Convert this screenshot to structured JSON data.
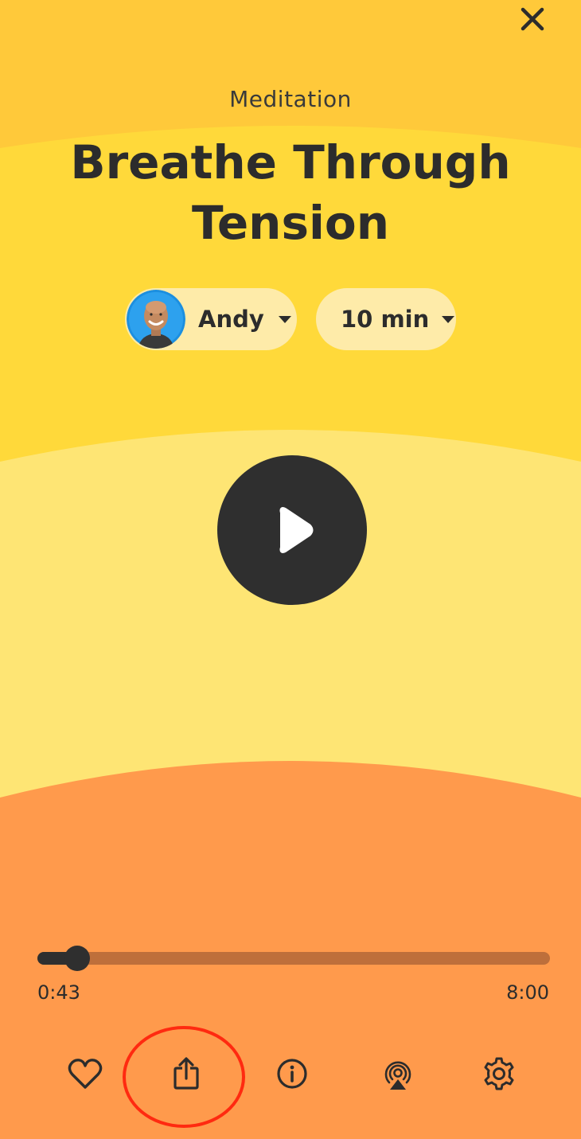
{
  "header": {
    "category": "Meditation",
    "title": "Breathe Through Tension",
    "close_icon": "close-icon"
  },
  "selectors": {
    "teacher": {
      "label": "Andy",
      "avatar": "teacher-avatar",
      "icon": "chevron-down-icon"
    },
    "duration": {
      "label": "10 min",
      "icon": "chevron-down-icon"
    }
  },
  "player": {
    "play_icon": "play-icon",
    "elapsed": "0:43",
    "total": "8:00",
    "progress_fraction": 0.078
  },
  "toolbar": {
    "icons": [
      "heart-icon",
      "share-icon",
      "info-icon",
      "airplay-icon",
      "gear-icon"
    ],
    "highlighted": "share-icon"
  },
  "colors": {
    "top_band": "#FFC93A",
    "mid_band": "#FFD93A",
    "light_band": "#FEE574",
    "bottom_band": "#FF9A4C",
    "pill": "#FEEBA9",
    "dark": "#2F2F2F",
    "track": "#BE6F3B",
    "annotation": "#FF2A10"
  }
}
